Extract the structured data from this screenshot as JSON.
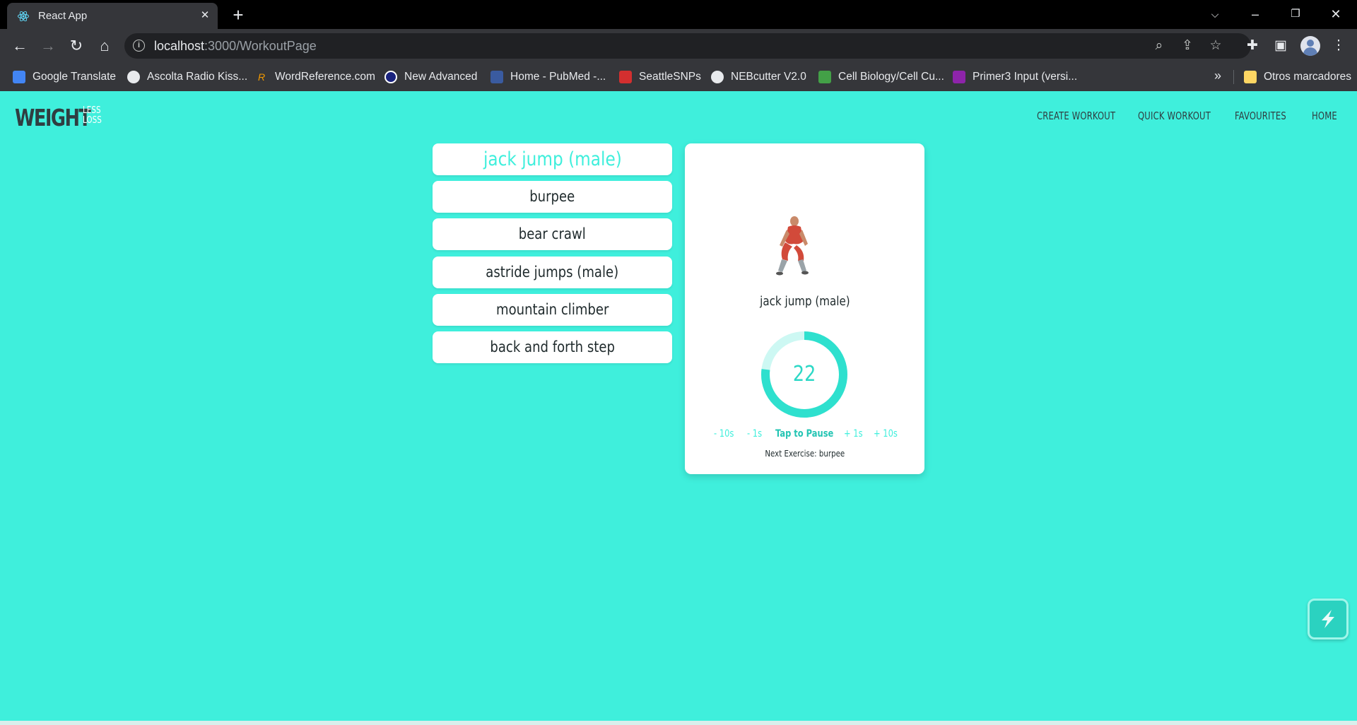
{
  "browser": {
    "tab_title": "React App",
    "url_host": "localhost",
    "url_path": ":3000/WorkoutPage",
    "bookmarks": [
      {
        "label": "Google Translate",
        "icon": "google-translate-icon",
        "color": "#4285f4"
      },
      {
        "label": "Ascolta Radio Kiss...",
        "icon": "globe-icon",
        "color": "#e8eaed"
      },
      {
        "label": "WordReference.com",
        "icon": "wordreference-icon",
        "color": "#f29900"
      },
      {
        "label": "New Advanced",
        "icon": "circle-logo-icon",
        "color": "#1a237e"
      },
      {
        "label": "Home - PubMed -...",
        "icon": "pubmed-icon",
        "color": "#3a5ba0"
      },
      {
        "label": "SeattleSNPs",
        "icon": "snps-icon",
        "color": "#d32f2f"
      },
      {
        "label": "NEBcutter V2.0",
        "icon": "globe-icon",
        "color": "#e8eaed"
      },
      {
        "label": "Cell Biology/Cell Cu...",
        "icon": "cell-biology-icon",
        "color": "#43a047"
      },
      {
        "label": "Primer3 Input (versi...",
        "icon": "primer3-icon",
        "color": "#8e24aa"
      }
    ],
    "other_bookmarks": "Otros marcadores",
    "more": "»"
  },
  "header": {
    "logo_main": "WEIGHT",
    "logo_sub1": "LESS",
    "logo_sub2": "LOSS",
    "nav": [
      "CREATE WORKOUT",
      "QUICK WORKOUT",
      "FAVOURITES",
      "HOME"
    ]
  },
  "exercises": [
    {
      "label": "jack jump (male)",
      "active": true
    },
    {
      "label": "burpee",
      "active": false
    },
    {
      "label": "bear crawl",
      "active": false
    },
    {
      "label": "astride jumps (male)",
      "active": false
    },
    {
      "label": "mountain climber",
      "active": false
    },
    {
      "label": "back and forth step",
      "active": false
    }
  ],
  "player": {
    "exercise_title": "jack jump (male)",
    "timer_value": "22",
    "timer_progress": 0.77,
    "controls": {
      "minus10": "- 10s",
      "minus1": "- 1s",
      "pause": "Tap to Pause",
      "plus1": "+ 1s",
      "plus10": "+ 10s"
    },
    "next_exercise": "Next Exercise: burpee"
  },
  "colors": {
    "accent": "#3fefdc",
    "accent_dark": "#23c4b3",
    "text_dark": "#2f3e41"
  }
}
